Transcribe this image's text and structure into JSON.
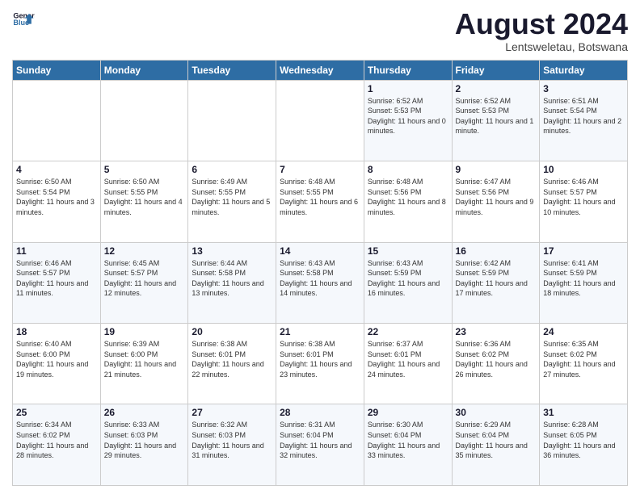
{
  "logo": {
    "line1": "General",
    "line2": "Blue"
  },
  "title": "August 2024",
  "subtitle": "Lentsweletau, Botswana",
  "headers": [
    "Sunday",
    "Monday",
    "Tuesday",
    "Wednesday",
    "Thursday",
    "Friday",
    "Saturday"
  ],
  "weeks": [
    [
      {
        "day": "",
        "info": ""
      },
      {
        "day": "",
        "info": ""
      },
      {
        "day": "",
        "info": ""
      },
      {
        "day": "",
        "info": ""
      },
      {
        "day": "1",
        "info": "Sunrise: 6:52 AM\nSunset: 5:53 PM\nDaylight: 11 hours and 0 minutes."
      },
      {
        "day": "2",
        "info": "Sunrise: 6:52 AM\nSunset: 5:53 PM\nDaylight: 11 hours and 1 minute."
      },
      {
        "day": "3",
        "info": "Sunrise: 6:51 AM\nSunset: 5:54 PM\nDaylight: 11 hours and 2 minutes."
      }
    ],
    [
      {
        "day": "4",
        "info": "Sunrise: 6:50 AM\nSunset: 5:54 PM\nDaylight: 11 hours and 3 minutes."
      },
      {
        "day": "5",
        "info": "Sunrise: 6:50 AM\nSunset: 5:55 PM\nDaylight: 11 hours and 4 minutes."
      },
      {
        "day": "6",
        "info": "Sunrise: 6:49 AM\nSunset: 5:55 PM\nDaylight: 11 hours and 5 minutes."
      },
      {
        "day": "7",
        "info": "Sunrise: 6:48 AM\nSunset: 5:55 PM\nDaylight: 11 hours and 6 minutes."
      },
      {
        "day": "8",
        "info": "Sunrise: 6:48 AM\nSunset: 5:56 PM\nDaylight: 11 hours and 8 minutes."
      },
      {
        "day": "9",
        "info": "Sunrise: 6:47 AM\nSunset: 5:56 PM\nDaylight: 11 hours and 9 minutes."
      },
      {
        "day": "10",
        "info": "Sunrise: 6:46 AM\nSunset: 5:57 PM\nDaylight: 11 hours and 10 minutes."
      }
    ],
    [
      {
        "day": "11",
        "info": "Sunrise: 6:46 AM\nSunset: 5:57 PM\nDaylight: 11 hours and 11 minutes."
      },
      {
        "day": "12",
        "info": "Sunrise: 6:45 AM\nSunset: 5:57 PM\nDaylight: 11 hours and 12 minutes."
      },
      {
        "day": "13",
        "info": "Sunrise: 6:44 AM\nSunset: 5:58 PM\nDaylight: 11 hours and 13 minutes."
      },
      {
        "day": "14",
        "info": "Sunrise: 6:43 AM\nSunset: 5:58 PM\nDaylight: 11 hours and 14 minutes."
      },
      {
        "day": "15",
        "info": "Sunrise: 6:43 AM\nSunset: 5:59 PM\nDaylight: 11 hours and 16 minutes."
      },
      {
        "day": "16",
        "info": "Sunrise: 6:42 AM\nSunset: 5:59 PM\nDaylight: 11 hours and 17 minutes."
      },
      {
        "day": "17",
        "info": "Sunrise: 6:41 AM\nSunset: 5:59 PM\nDaylight: 11 hours and 18 minutes."
      }
    ],
    [
      {
        "day": "18",
        "info": "Sunrise: 6:40 AM\nSunset: 6:00 PM\nDaylight: 11 hours and 19 minutes."
      },
      {
        "day": "19",
        "info": "Sunrise: 6:39 AM\nSunset: 6:00 PM\nDaylight: 11 hours and 21 minutes."
      },
      {
        "day": "20",
        "info": "Sunrise: 6:38 AM\nSunset: 6:01 PM\nDaylight: 11 hours and 22 minutes."
      },
      {
        "day": "21",
        "info": "Sunrise: 6:38 AM\nSunset: 6:01 PM\nDaylight: 11 hours and 23 minutes."
      },
      {
        "day": "22",
        "info": "Sunrise: 6:37 AM\nSunset: 6:01 PM\nDaylight: 11 hours and 24 minutes."
      },
      {
        "day": "23",
        "info": "Sunrise: 6:36 AM\nSunset: 6:02 PM\nDaylight: 11 hours and 26 minutes."
      },
      {
        "day": "24",
        "info": "Sunrise: 6:35 AM\nSunset: 6:02 PM\nDaylight: 11 hours and 27 minutes."
      }
    ],
    [
      {
        "day": "25",
        "info": "Sunrise: 6:34 AM\nSunset: 6:02 PM\nDaylight: 11 hours and 28 minutes."
      },
      {
        "day": "26",
        "info": "Sunrise: 6:33 AM\nSunset: 6:03 PM\nDaylight: 11 hours and 29 minutes."
      },
      {
        "day": "27",
        "info": "Sunrise: 6:32 AM\nSunset: 6:03 PM\nDaylight: 11 hours and 31 minutes."
      },
      {
        "day": "28",
        "info": "Sunrise: 6:31 AM\nSunset: 6:04 PM\nDaylight: 11 hours and 32 minutes."
      },
      {
        "day": "29",
        "info": "Sunrise: 6:30 AM\nSunset: 6:04 PM\nDaylight: 11 hours and 33 minutes."
      },
      {
        "day": "30",
        "info": "Sunrise: 6:29 AM\nSunset: 6:04 PM\nDaylight: 11 hours and 35 minutes."
      },
      {
        "day": "31",
        "info": "Sunrise: 6:28 AM\nSunset: 6:05 PM\nDaylight: 11 hours and 36 minutes."
      }
    ]
  ]
}
